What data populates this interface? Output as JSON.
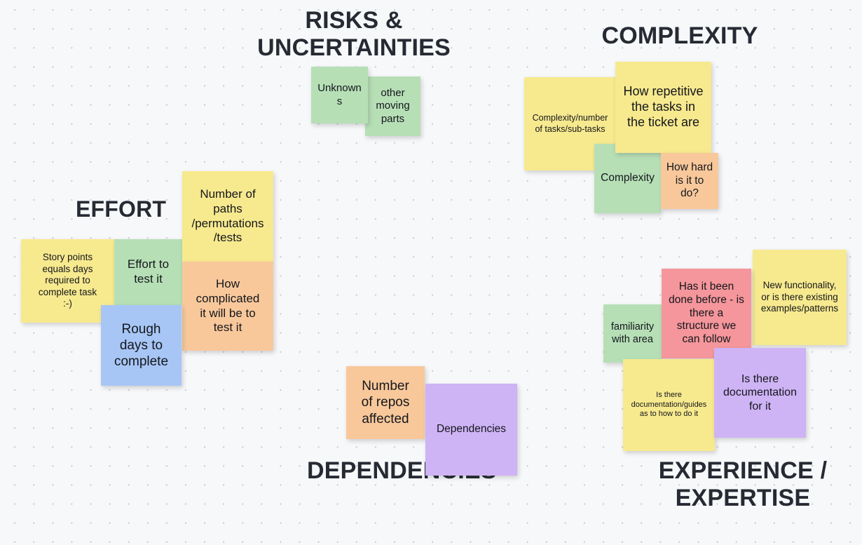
{
  "board": {
    "background_color": "#f7f8fa",
    "dot_color": "#c9ccd4",
    "title_color": "#262a33",
    "note_text_color": "#15171c"
  },
  "palette": {
    "yellow": "#f7e98e",
    "green": "#b6dfb6",
    "orange": "#f8c89b",
    "blue": "#a7c6f5",
    "pink": "#f4969b",
    "purple": "#ceb3f5"
  },
  "sections": [
    {
      "id": "effort",
      "title": "EFFORT"
    },
    {
      "id": "risks",
      "title": "RISKS &\nUNCERTAINTIES"
    },
    {
      "id": "complexity",
      "title": "COMPLEXITY"
    },
    {
      "id": "dependencies",
      "title": "DEPENDENCIES"
    },
    {
      "id": "experience",
      "title": "EXPERIENCE /\nEXPERTISE"
    }
  ],
  "notes": [
    {
      "id": "unknowns",
      "section": "risks",
      "text": "Unknowns",
      "color": "green"
    },
    {
      "id": "other-moving-parts",
      "section": "risks",
      "text": "other\nmoving\nparts",
      "color": "green"
    },
    {
      "id": "complexity-number",
      "section": "complexity",
      "text": "Complexity/number\nof tasks/sub-tasks",
      "color": "yellow"
    },
    {
      "id": "how-repetitive",
      "section": "complexity",
      "text": "How repetitive\nthe tasks in\nthe ticket are",
      "color": "yellow"
    },
    {
      "id": "complexity",
      "section": "complexity",
      "text": "Complexity",
      "color": "green"
    },
    {
      "id": "how-hard",
      "section": "complexity",
      "text": "How hard\nis it to\ndo?",
      "color": "orange"
    },
    {
      "id": "number-of-paths",
      "section": "effort",
      "text": "Number of\npaths\n/permutations\n/tests",
      "color": "yellow"
    },
    {
      "id": "story-points",
      "section": "effort",
      "text": "Story points\nequals days\nrequired to\ncomplete task\n:-)",
      "color": "yellow"
    },
    {
      "id": "effort-to-test",
      "section": "effort",
      "text": "Effort to\ntest it",
      "color": "green"
    },
    {
      "id": "how-complicated",
      "section": "effort",
      "text": "How\ncomplicated\nit will be to\ntest it",
      "color": "orange"
    },
    {
      "id": "rough-days",
      "section": "effort",
      "text": "Rough\ndays to\ncomplete",
      "color": "blue"
    },
    {
      "id": "number-of-repos",
      "section": "dependencies",
      "text": "Number\nof repos\naffected",
      "color": "orange"
    },
    {
      "id": "dependencies",
      "section": "dependencies",
      "text": "Dependencies",
      "color": "purple"
    },
    {
      "id": "familiarity",
      "section": "experience",
      "text": "familiarity\nwith area",
      "color": "green"
    },
    {
      "id": "has-it-been-done",
      "section": "experience",
      "text": "Has it been\ndone before - is\nthere a\nstructure we\ncan follow",
      "color": "pink"
    },
    {
      "id": "new-functionality",
      "section": "experience",
      "text": "New functionality,\nor is there existing\nexamples/patterns",
      "color": "yellow"
    },
    {
      "id": "is-there-docs-guides",
      "section": "experience",
      "text": "Is there\ndocumentation/guides\nas to how to do it",
      "color": "yellow"
    },
    {
      "id": "is-there-docs-for-it",
      "section": "experience",
      "text": "Is there\ndocumentation\nfor it",
      "color": "purple"
    }
  ]
}
